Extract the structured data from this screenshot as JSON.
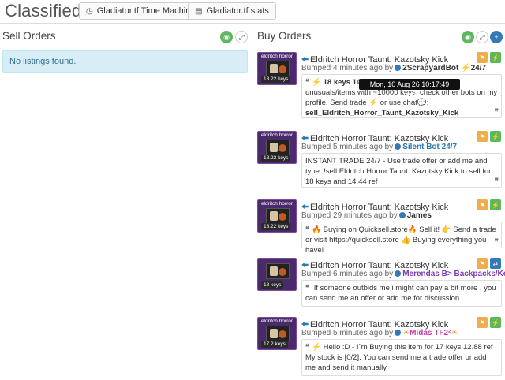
{
  "header": {
    "title": "Classifieds",
    "btn_time_machine": "Gladiator.tf Time Machine",
    "btn_stats": "Gladiator.tf stats"
  },
  "sell": {
    "title": "Sell Orders",
    "empty_text": "No listings found."
  },
  "buy": {
    "title": "Buy Orders"
  },
  "listings": [
    {
      "item_label": "eldritch horror",
      "price_badge": "18.22 keys",
      "title": "Eldritch Horror Taunt: Kazotsky Kick",
      "bumped": "Bumped 4 minutes ago by",
      "user": "2ScrapyardBot",
      "user_suffix": "24/7",
      "comment_a": "18 keys 14",
      "comment_b": "sands of unusuals/items with ~10000 keys, check other bots on my profile. Send trade",
      "comment_c": "or use chat",
      "comment_d": "sell_Eldritch_Horror_Taunt_Kazotsky_Kick"
    },
    {
      "item_label": "eldritch horror",
      "price_badge": "18.22 keys",
      "title": "Eldritch Horror Taunt: Kazotsky Kick",
      "bumped": "Bumped 5 minutes ago by",
      "user": "Silent Bot 24/7",
      "comment": "INSTANT TRADE 24/7 - Use trade offer or add me and type: !sell Eldritch Horror Taunt: Kazotsky Kick to sell for 18 keys and 14.44 ref"
    },
    {
      "item_label": "eldritch horror",
      "price_badge": "18.22 keys",
      "title": "Eldritch Horror Taunt: Kazotsky Kick",
      "bumped": "Bumped 29 minutes ago by",
      "user": "James",
      "comment_a": "Buying on Quicksell.store",
      "comment_b": "Sell it!",
      "comment_c": "Send a trade or visit https://quicksell.store",
      "comment_d": "Buying everything you have!"
    },
    {
      "item_label": "",
      "price_badge": "18 keys",
      "title": "Eldritch Horror Taunt: Kazotsky Kick",
      "bumped": "Bumped 6 minutes ago by",
      "user": "Merendas B> Backpacks/Keys",
      "comment": "If someone outbids me i might can pay a bit more , you can send me an offer or add me for discussion ."
    },
    {
      "item_label": "eldritch horror",
      "price_badge": "17.2 keys",
      "title": "Eldritch Horror Taunt: Kazotsky Kick",
      "bumped": "Bumped 5 minutes ago by",
      "user": "Midas TF2²",
      "comment": "Hello :D - I`m Buying this item for 17 keys 12.88 ref My stock is [0/2]. You can send me a trade offer or add me and send it manually."
    }
  ],
  "tooltip": "Mon, 10 Aug 26 10:17:49 +0000",
  "colors": {
    "accent_blue": "#337ab7",
    "green": "#5cb85c",
    "orange": "#f0ad4e",
    "info_bg": "#d9edf7"
  }
}
